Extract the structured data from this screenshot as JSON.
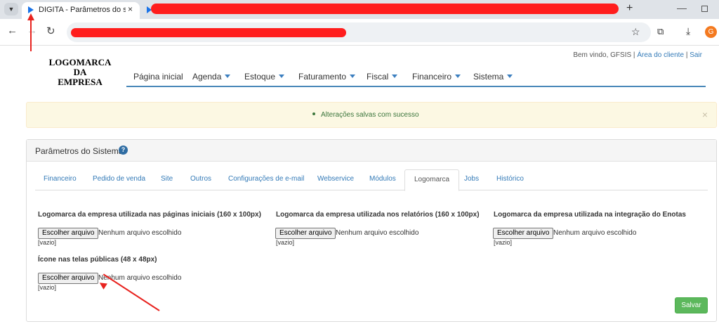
{
  "browser": {
    "tab_list_icon": "chevron-down-icon",
    "active_tab_title": "DIGITA - Parâmetros do siste",
    "new_tab_label": "+",
    "close_glyph": "×",
    "back_glyph": "←",
    "forward_glyph": "→",
    "reload_glyph": "↻",
    "bookmark_glyph": "☆",
    "extensions_glyph": "⧉",
    "download_glyph": "⤓",
    "profile_initial": "G",
    "minimize_glyph": "—",
    "redaction_color": "#ff1d1d"
  },
  "header": {
    "logo_line1": "LOGOMARCA",
    "logo_line2": "DA",
    "logo_line3": "EMPRESA",
    "welcome_text": "Bem vindo, GFSIS",
    "separator": "|",
    "client_area_link": "Área do cliente",
    "logout_link": "Sair"
  },
  "nav": {
    "items": [
      {
        "label": "Página inicial",
        "dropdown": false
      },
      {
        "label": "Agenda",
        "dropdown": true
      },
      {
        "label": "Estoque",
        "dropdown": true
      },
      {
        "label": "Faturamento",
        "dropdown": true
      },
      {
        "label": "Fiscal",
        "dropdown": true
      },
      {
        "label": "Financeiro",
        "dropdown": true
      },
      {
        "label": "Sistema",
        "dropdown": true
      }
    ]
  },
  "alert": {
    "message": "Alterações salvas com sucesso",
    "close": "×",
    "color": "#3c763d"
  },
  "panel": {
    "title": "Parâmetros do Sistema",
    "help_glyph": "?",
    "tabs": [
      "Financeiro",
      "Pedido de venda",
      "Site",
      "Outros",
      "Configurações de e-mail",
      "Webservice",
      "Módulos",
      "Logomarca",
      "Jobs",
      "Histórico"
    ],
    "active_tab": "Logomarca",
    "fields": [
      {
        "label": "Logomarca da empresa utilizada nas páginas iniciais (160 x 100px)",
        "button": "Escolher arquivo",
        "status": "Nenhum arquivo escolhido",
        "current": "[vazio]"
      },
      {
        "label": "Logomarca da empresa utilizada nos relatórios (160 x 100px)",
        "button": "Escolher arquivo",
        "status": "Nenhum arquivo escolhido",
        "current": "[vazio]"
      },
      {
        "label": "Logomarca da empresa utilizada na integração do Enotas",
        "button": "Escolher arquivo",
        "status": "Nenhum arquivo escolhido",
        "current": "[vazio]"
      },
      {
        "label": "Ícone nas telas públicas (48 x 48px)",
        "button": "Escolher arquivo",
        "status": "Nenhum arquivo escolhido",
        "current": "[vazio]"
      }
    ],
    "save_label": "Salvar",
    "save_color": "#5cb85c"
  },
  "annotations": {
    "arrow_color": "#e8231f"
  }
}
